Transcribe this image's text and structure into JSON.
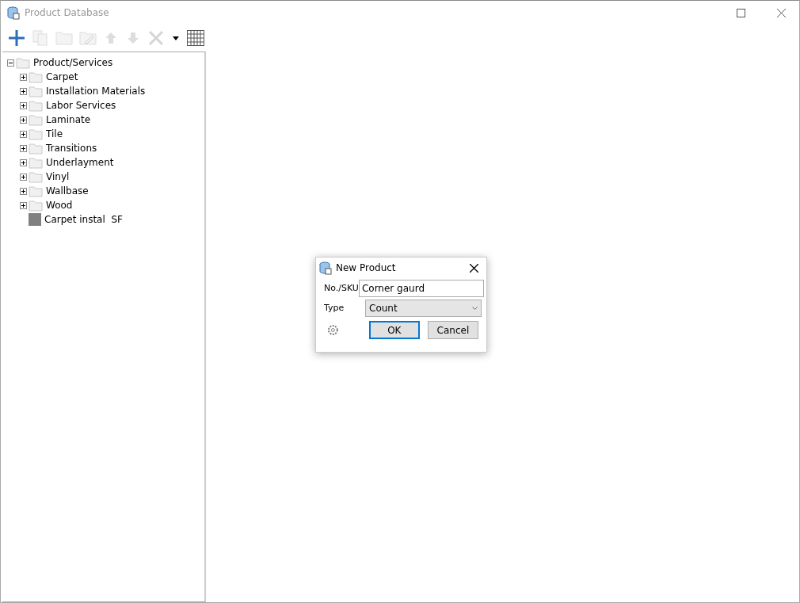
{
  "window": {
    "title": "Product Database",
    "active": false
  },
  "toolbar": [
    {
      "kind": "add",
      "disabled": false
    },
    {
      "kind": "copy",
      "disabled": true
    },
    {
      "kind": "folder",
      "disabled": true
    },
    {
      "kind": "edit",
      "disabled": true
    },
    {
      "kind": "up",
      "disabled": true
    },
    {
      "kind": "down",
      "disabled": true
    },
    {
      "kind": "delete",
      "disabled": true
    },
    {
      "kind": "caret",
      "disabled": false
    },
    {
      "kind": "grid",
      "disabled": false
    }
  ],
  "tree": {
    "label": "Product/Services",
    "kind": "folder",
    "expanded": true,
    "children": [
      {
        "label": "Carpet",
        "kind": "folder",
        "expanded": false
      },
      {
        "label": "Installation Materials",
        "kind": "folder",
        "expanded": false
      },
      {
        "label": "Labor Services",
        "kind": "folder",
        "expanded": false
      },
      {
        "label": "Laminate",
        "kind": "folder",
        "expanded": false
      },
      {
        "label": "Tile",
        "kind": "folder",
        "expanded": false
      },
      {
        "label": "Transitions",
        "kind": "folder",
        "expanded": false
      },
      {
        "label": "Underlayment",
        "kind": "folder",
        "expanded": false
      },
      {
        "label": "Vinyl",
        "kind": "folder",
        "expanded": false
      },
      {
        "label": "Wallbase",
        "kind": "folder",
        "expanded": false
      },
      {
        "label": "Wood",
        "kind": "folder",
        "expanded": false
      },
      {
        "label": "Carpet instal  SF",
        "kind": "product"
      }
    ]
  },
  "dialog": {
    "title": "New Product",
    "sku_label": "No./SKU",
    "sku_value": "Corner gaurd",
    "type_label": "Type",
    "type_value": "Count",
    "buttons": [
      {
        "label": "OK",
        "default": true
      },
      {
        "label": "Cancel",
        "default": false
      }
    ]
  }
}
